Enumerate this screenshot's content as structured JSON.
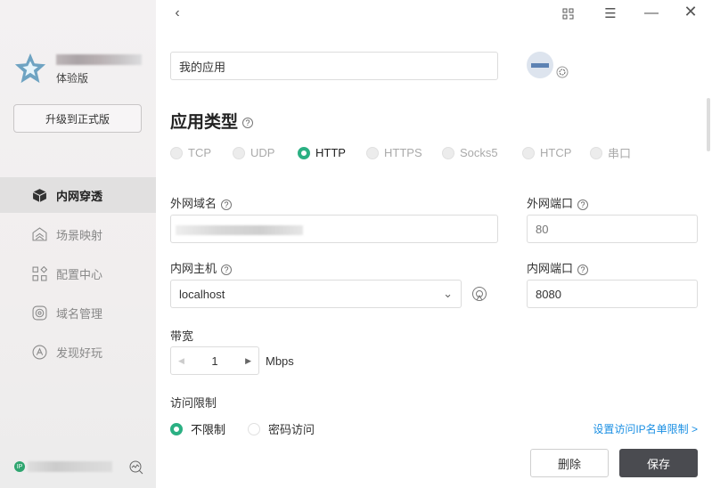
{
  "sidebar": {
    "edition": "体验版",
    "upgrade_label": "升级到正式版",
    "items": [
      {
        "label": "内网穿透",
        "icon": "cube-icon"
      },
      {
        "label": "场景映射",
        "icon": "scene-icon"
      },
      {
        "label": "配置中心",
        "icon": "grid-icon"
      },
      {
        "label": "域名管理",
        "icon": "domain-icon"
      },
      {
        "label": "发现好玩",
        "icon": "discover-icon"
      }
    ],
    "ip_badge": "IP"
  },
  "form": {
    "app_name": "我的应用",
    "section_title": "应用类型",
    "types": [
      "TCP",
      "UDP",
      "HTTP",
      "HTTPS",
      "Socks5",
      "HTCP",
      "串口"
    ],
    "selected_type": "HTTP",
    "external_domain_label": "外网域名",
    "external_port_label": "外网端口",
    "external_port_placeholder": "80",
    "internal_host_label": "内网主机",
    "internal_host_value": "localhost",
    "internal_port_label": "内网端口",
    "internal_port_value": "8080",
    "bandwidth_label": "带宽",
    "bandwidth_value": "1",
    "bandwidth_unit": "Mbps",
    "access_label": "访问限制",
    "access_options": [
      "不限制",
      "密码访问"
    ],
    "ip_whitelist_link": "设置访问IP名单限制 >",
    "delete_label": "删除",
    "save_label": "保存"
  },
  "colors": {
    "accent": "#2bb083",
    "link": "#1a8fe3",
    "save_bg": "#4a4b50"
  }
}
